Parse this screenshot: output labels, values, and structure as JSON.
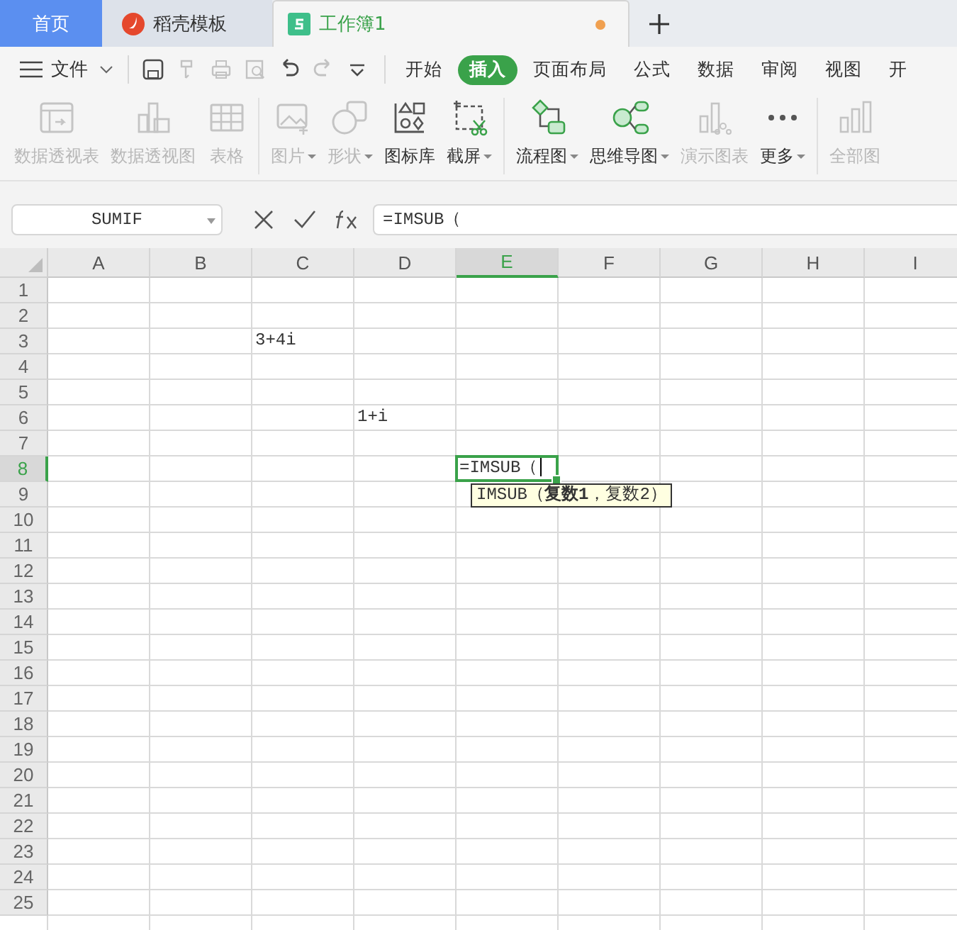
{
  "tabs": [
    {
      "label": "首页",
      "kind": "home",
      "selected": false
    },
    {
      "label": "稻壳模板",
      "kind": "template",
      "selected": false
    },
    {
      "label": "工作簿1",
      "kind": "sheet",
      "selected": true,
      "modified": true
    }
  ],
  "menu": {
    "file_label": "文件"
  },
  "quick_access": [
    {
      "disabled": false
    },
    {
      "disabled": true
    },
    {
      "disabled": true
    },
    {
      "disabled": true
    },
    {
      "disabled": false
    },
    {
      "disabled": true
    },
    {
      "disabled": false
    }
  ],
  "ribbon_tabs": [
    {
      "label": "开始",
      "selected": false
    },
    {
      "label": "插入",
      "selected": true
    },
    {
      "label": "页面布局",
      "selected": false
    },
    {
      "label": "公式",
      "selected": false
    },
    {
      "label": "数据",
      "selected": false
    },
    {
      "label": "审阅",
      "selected": false
    },
    {
      "label": "视图",
      "selected": false
    },
    {
      "label": "开",
      "selected": false
    }
  ],
  "ribbon_groups": [
    [
      {
        "label": "数据透视表",
        "disabled": true,
        "dropdown": false
      },
      {
        "label": "数据透视图",
        "disabled": true,
        "dropdown": false
      },
      {
        "label": "表格",
        "disabled": true,
        "dropdown": false
      }
    ],
    [
      {
        "label": "图片",
        "disabled": true,
        "dropdown": true
      },
      {
        "label": "形状",
        "disabled": true,
        "dropdown": true
      },
      {
        "label": "图标库",
        "disabled": false,
        "dropdown": false
      },
      {
        "label": "截屏",
        "disabled": false,
        "dropdown": true
      }
    ],
    [
      {
        "label": "流程图",
        "disabled": false,
        "dropdown": true
      },
      {
        "label": "思维导图",
        "disabled": false,
        "dropdown": true
      },
      {
        "label": "演示图表",
        "disabled": true,
        "dropdown": false
      },
      {
        "label": "更多",
        "disabled": false,
        "dropdown": true
      }
    ],
    [
      {
        "label": "全部图",
        "disabled": true,
        "dropdown": false
      }
    ]
  ],
  "name_box": "SUMIF",
  "formula": "=IMSUB（",
  "columns": [
    {
      "label": "A",
      "selected": false
    },
    {
      "label": "B",
      "selected": false
    },
    {
      "label": "C",
      "selected": false
    },
    {
      "label": "D",
      "selected": false
    },
    {
      "label": "E",
      "selected": true
    },
    {
      "label": "F",
      "selected": false
    },
    {
      "label": "G",
      "selected": false
    },
    {
      "label": "H",
      "selected": false
    },
    {
      "label": "I",
      "selected": false
    }
  ],
  "rows": [
    {
      "label": "1",
      "selected": false
    },
    {
      "label": "2",
      "selected": false
    },
    {
      "label": "3",
      "selected": false,
      "cells": [
        null,
        null,
        {
          "text": "3+4i",
          "active": false
        }
      ]
    },
    {
      "label": "4",
      "selected": false
    },
    {
      "label": "5",
      "selected": false
    },
    {
      "label": "6",
      "selected": false,
      "cells": [
        null,
        null,
        null,
        {
          "text": "1+i",
          "active": false
        }
      ]
    },
    {
      "label": "7",
      "selected": false
    },
    {
      "label": "8",
      "selected": true,
      "cells": [
        null,
        null,
        null,
        null,
        {
          "text": "=IMSUB（",
          "active": true
        }
      ]
    },
    {
      "label": "9",
      "selected": false
    },
    {
      "label": "10",
      "selected": false
    },
    {
      "label": "11",
      "selected": false
    },
    {
      "label": "12",
      "selected": false
    },
    {
      "label": "13",
      "selected": false
    },
    {
      "label": "14",
      "selected": false
    },
    {
      "label": "15",
      "selected": false
    },
    {
      "label": "16",
      "selected": false
    },
    {
      "label": "17",
      "selected": false
    },
    {
      "label": "18",
      "selected": false
    },
    {
      "label": "19",
      "selected": false
    },
    {
      "label": "20",
      "selected": false
    },
    {
      "label": "21",
      "selected": false
    },
    {
      "label": "22",
      "selected": false
    },
    {
      "label": "23",
      "selected": false
    },
    {
      "label": "24",
      "selected": false
    },
    {
      "label": "25",
      "selected": false
    }
  ],
  "tooltip": "IMSUB（**复数1**，复数2）"
}
